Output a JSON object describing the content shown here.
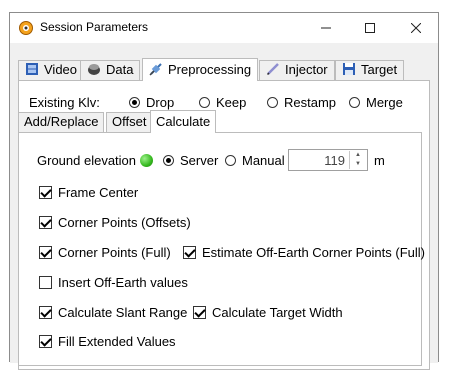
{
  "window": {
    "title": "Session Parameters",
    "min_icon": "minimize-icon",
    "max_icon": "maximize-icon",
    "close_icon": "close-icon"
  },
  "main_tabs": [
    {
      "label": "Video",
      "icon": "film-icon",
      "active": false
    },
    {
      "label": "Data",
      "icon": "data-icon",
      "active": false
    },
    {
      "label": "Preprocessing",
      "icon": "satellite-icon",
      "active": true
    },
    {
      "label": "Injector",
      "icon": "pen-icon",
      "active": false
    },
    {
      "label": "Target",
      "icon": "save-icon",
      "active": false
    }
  ],
  "existing_klv": {
    "label": "Existing Klv:",
    "options": [
      {
        "label": "Drop",
        "checked": true
      },
      {
        "label": "Keep",
        "checked": false
      },
      {
        "label": "Restamp",
        "checked": false
      },
      {
        "label": "Merge",
        "checked": false
      }
    ]
  },
  "sub_tabs": [
    {
      "label": "Add/Replace",
      "active": false
    },
    {
      "label": "Offset",
      "active": false
    },
    {
      "label": "Calculate",
      "active": true
    }
  ],
  "ground_elevation": {
    "label": "Ground elevation",
    "status_color": "#35b81e",
    "options": [
      {
        "label": "Server",
        "checked": true
      },
      {
        "label": "Manual",
        "checked": false
      }
    ],
    "value": "119",
    "unit": "m"
  },
  "checkboxes": {
    "frame_center": {
      "label": "Frame Center",
      "checked": true
    },
    "corner_offsets": {
      "label": "Corner Points (Offsets)",
      "checked": true
    },
    "corner_full": {
      "label": "Corner Points (Full)",
      "checked": true
    },
    "estimate_off_earth": {
      "label": "Estimate Off-Earth Corner Points (Full)",
      "checked": true
    },
    "insert_off_earth": {
      "label": "Insert Off-Earth values",
      "checked": false
    },
    "slant_range": {
      "label": "Calculate Slant Range",
      "checked": true
    },
    "target_width": {
      "label": "Calculate Target Width",
      "checked": true
    },
    "fill_extended": {
      "label": "Fill Extended Values",
      "checked": true
    }
  }
}
